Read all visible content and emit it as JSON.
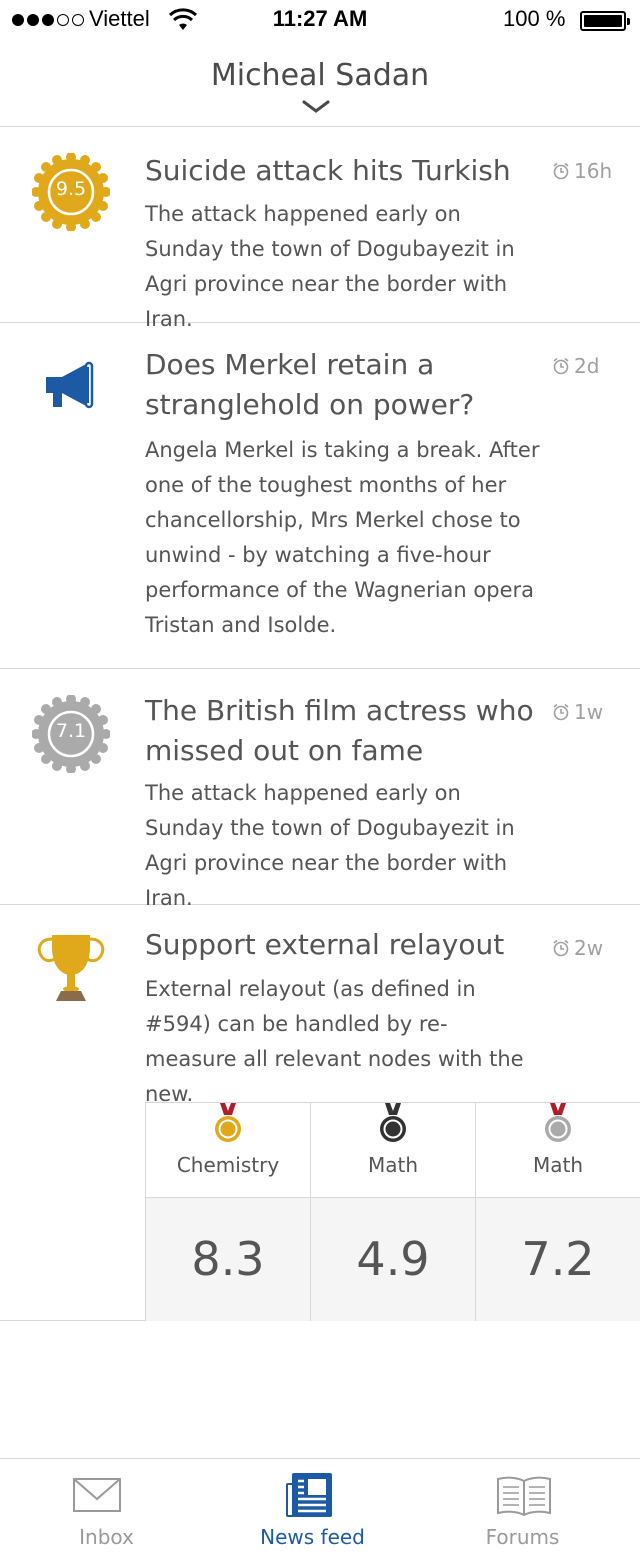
{
  "status_bar": {
    "carrier": "Viettel",
    "time": "11:27 AM",
    "battery": "100 %"
  },
  "header": {
    "title": "Micheal Sadan"
  },
  "feed": [
    {
      "title": "Suicide attack hits Turkish",
      "body": "The attack happened early on Sunday the town of Dogubayezit in Agri province near the border with Iran.",
      "time": "16h",
      "icon": "score-badge-gold-icon",
      "badge": "9.5"
    },
    {
      "title": "Does Merkel retain a stranglehold on power?",
      "body": "Angela Merkel is taking a break. After one of the toughest months of her chancellorship, Mrs Merkel chose to unwind - by watching a five-hour performance of the Wagnerian opera Tristan and Isolde.",
      "time": "2d",
      "icon": "megaphone-icon"
    },
    {
      "title": "The British film actress who missed out on fame",
      "body": "The attack happened early on Sunday the town of Dogubayezit in Agri province near the border with Iran.",
      "time": "1w",
      "icon": "score-badge-silver-icon",
      "badge": "7.1"
    },
    {
      "title": "Support external relayout",
      "body": "External relayout (as defined in #594) can be handled by re-measure all relevant nodes with the new.",
      "time": "2w",
      "icon": "trophy-icon"
    }
  ],
  "scores": [
    {
      "subject": "Chemistry",
      "value": "8.3",
      "medal": "gold-medal-icon",
      "medal_color": "#e0a91b"
    },
    {
      "subject": "Math",
      "value": "4.9",
      "medal": "black-medal-icon",
      "medal_color": "#333333"
    },
    {
      "subject": "Math",
      "value": "7.2",
      "medal": "silver-medal-icon",
      "medal_color": "#aaaaaa"
    }
  ],
  "tabs": [
    {
      "label": "Inbox",
      "icon": "mail-icon",
      "active": false
    },
    {
      "label": "News feed",
      "icon": "newspaper-icon",
      "active": true
    },
    {
      "label": "Forums",
      "icon": "book-icon",
      "active": false
    }
  ],
  "colors": {
    "accent": "#1d5aa5",
    "gold": "#e0a91b",
    "silver": "#aaaaaa"
  }
}
